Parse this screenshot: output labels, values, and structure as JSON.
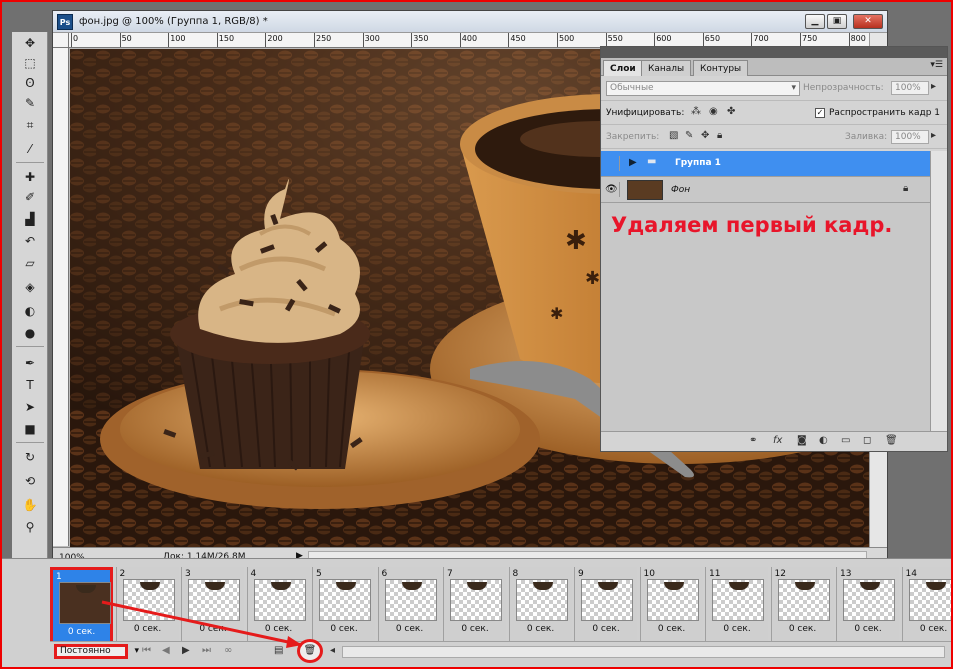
{
  "document": {
    "title": "фон.jpg @ 100% (Группа 1, RGB/8) *",
    "zoom": "100%",
    "doc_info": "Док: 1,14M/26,8M",
    "ruler_labels": [
      "0",
      "50",
      "100",
      "150",
      "200",
      "250",
      "300",
      "350",
      "400",
      "450",
      "500",
      "550",
      "600",
      "650",
      "700",
      "750",
      "800"
    ]
  },
  "layers_panel": {
    "tabs": [
      "Слои",
      "Каналы",
      "Контуры"
    ],
    "blend_mode": "Обычные",
    "opacity_label": "Непрозрачность:",
    "opacity_value": "100%",
    "unify_label": "Унифицировать:",
    "propagate_label": "Распространить кадр 1",
    "lock_label": "Закрепить:",
    "fill_label": "Заливка:",
    "fill_value": "100%",
    "layers": [
      {
        "name": "Группа 1",
        "selected": true
      },
      {
        "name": "Фон",
        "selected": false
      }
    ]
  },
  "annotation": "Удаляем первый кадр.",
  "animation": {
    "frames": [
      {
        "num": "1",
        "delay": "0 сек."
      },
      {
        "num": "2",
        "delay": "0 сек."
      },
      {
        "num": "3",
        "delay": "0 сек."
      },
      {
        "num": "4",
        "delay": "0 сек."
      },
      {
        "num": "5",
        "delay": "0 сек."
      },
      {
        "num": "6",
        "delay": "0 сек."
      },
      {
        "num": "7",
        "delay": "0 сек."
      },
      {
        "num": "8",
        "delay": "0 сек."
      },
      {
        "num": "9",
        "delay": "0 сек."
      },
      {
        "num": "10",
        "delay": "0 сек."
      },
      {
        "num": "11",
        "delay": "0 сек."
      },
      {
        "num": "12",
        "delay": "0 сек."
      },
      {
        "num": "13",
        "delay": "0 сек."
      },
      {
        "num": "14",
        "delay": "0 сек."
      }
    ],
    "loop": "Постоянно"
  },
  "colors": {
    "annotation": "#e8152a",
    "selection": "#3f8ff0",
    "highlight": "#e51b1b"
  }
}
